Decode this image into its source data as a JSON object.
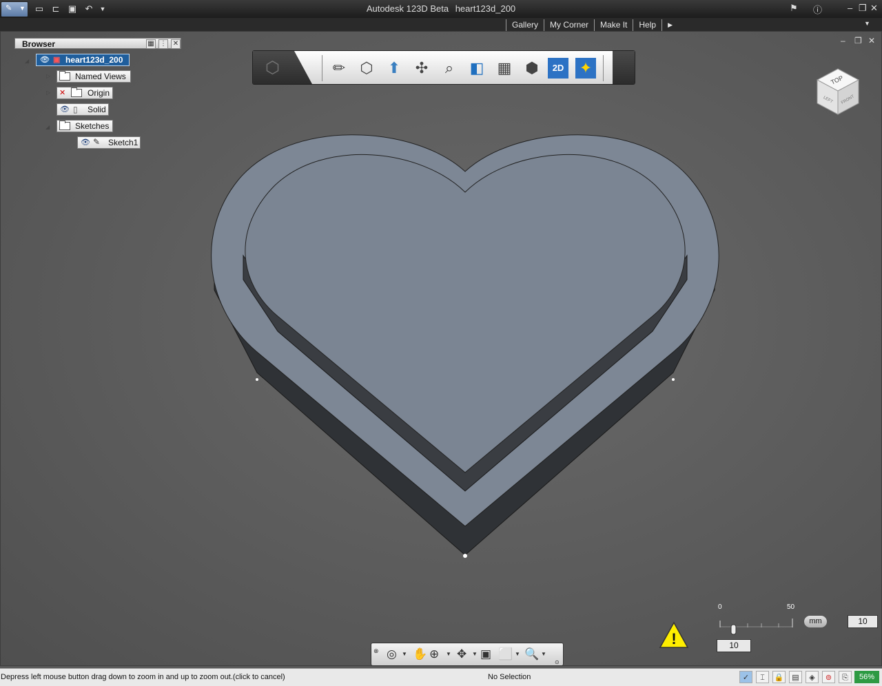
{
  "title_bar": {
    "app_name": "Autodesk 123D Beta",
    "document_name": "heart123d_200",
    "quick_access": [
      "new-file-icon",
      "open-file-icon",
      "save-icon",
      "undo-icon",
      "dropdown-arrow-icon"
    ]
  },
  "menu": {
    "items": [
      "Gallery",
      "My Corner",
      "Make It",
      "Help"
    ]
  },
  "browser": {
    "title": "Browser",
    "root": "heart123d_200",
    "nodes": {
      "named_views": "Named Views",
      "origin": "Origin",
      "solid": "Solid",
      "sketches": "Sketches",
      "sketch1": "Sketch1"
    }
  },
  "toolbar": {
    "tools": [
      "sketch-pencil-icon",
      "primitive-box-icon",
      "extrude-icon",
      "move-icon",
      "inspect-icon",
      "combine-icon",
      "pattern-icon",
      "group-icon",
      "2d-drawing-icon",
      "materials-icon"
    ]
  },
  "viewcube": {
    "top": "TOP",
    "left": "LEFT",
    "front": "FRONT"
  },
  "grid_controls": {
    "ruler_min": "0",
    "ruler_max": "50",
    "unit": "mm",
    "grid_value": "10",
    "snap_value": "10"
  },
  "navigation_bar": {
    "tools": [
      "orbit-icon",
      "pan-icon",
      "zoom-icon",
      "look-at-icon",
      "fit-icon",
      "view-icon",
      "inspect-icon"
    ]
  },
  "status_bar": {
    "message": "Depress left mouse button drag down to zoom in and up to zoom out.(click to cancel)",
    "selection": "No Selection",
    "zoom": "56%"
  },
  "colors": {
    "viewport_bg": "#5a5a5a",
    "model_face": "#7d8795",
    "model_side": "#2f3236",
    "selection_blue": "#1f5e9c",
    "zoom_green": "#2d9a43"
  }
}
